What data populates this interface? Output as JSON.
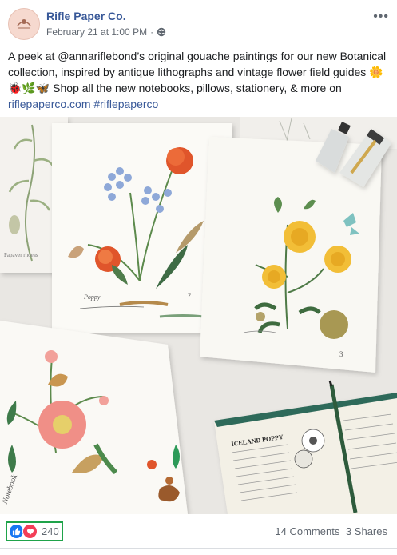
{
  "post": {
    "page_name": "Rifle Paper Co.",
    "timestamp": "February 21 at 1:00 PM",
    "separator": "·",
    "privacy_icon": "globe-icon",
    "more_icon": "more-options-icon",
    "text_line1": "A peek at @annariflebond’s original gouache paintings for our new Botanical collection, inspired by antique lithographs and vintage flower field guides",
    "emoji_sun": "🌼",
    "emoji_row": "🐞🌿🦋",
    "text_line2": " Shop all the new notebooks, pillows, stationery, & more on",
    "link_text": "riflepaperco.com",
    "hashtag": "#riflepaperco"
  },
  "photo": {
    "book_title": "ICELAND POPPY",
    "card1_caption": "Poppy",
    "card1_number": "2"
  },
  "reactions": {
    "count": "240",
    "icons": [
      "like-icon",
      "love-icon"
    ],
    "colors": {
      "like": "#1877f2",
      "love": "#f33e58",
      "highlight": "#1fa34a"
    }
  },
  "stats": {
    "comments": "14 Comments",
    "shares": "3 Shares"
  }
}
